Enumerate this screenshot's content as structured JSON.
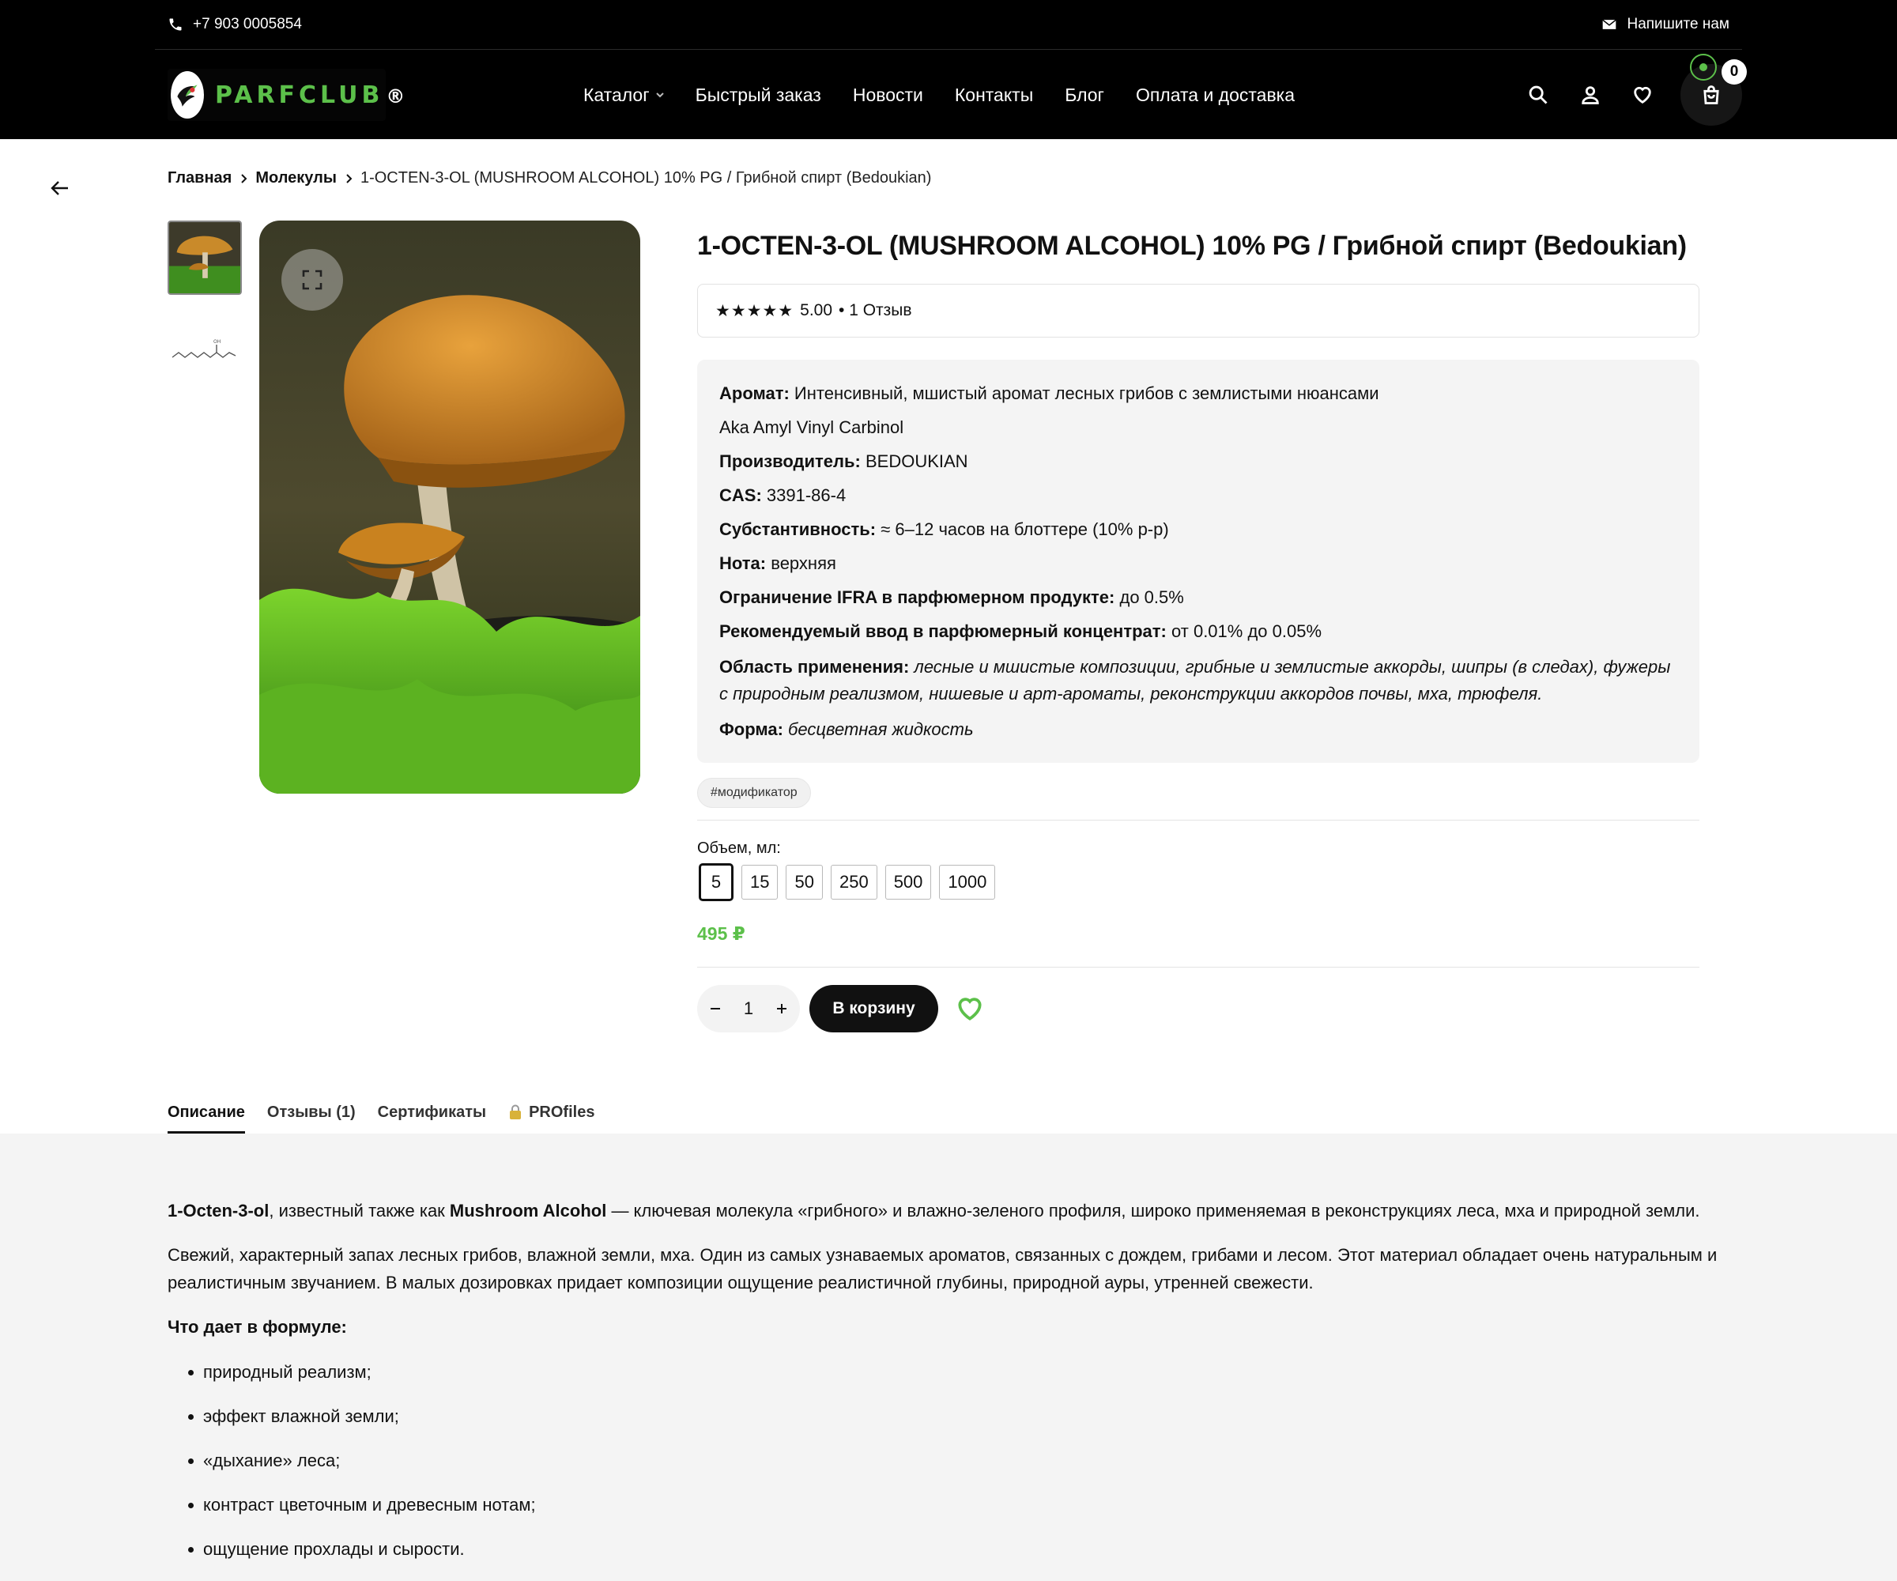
{
  "topbar": {
    "phone": "+7 903 0005854",
    "write_us": "Напишите нам"
  },
  "nav": {
    "logo_text": "PARFCLUB",
    "logo_mark": "®",
    "items": [
      {
        "label": "Каталог"
      },
      {
        "label": "Быстрый заказ"
      },
      {
        "label": "Новости"
      },
      {
        "label": "Контакты"
      },
      {
        "label": "Блог"
      },
      {
        "label": "Оплата и доставка"
      }
    ],
    "cart_count": "0"
  },
  "breadcrumb": {
    "home": "Главная",
    "section": "Молекулы",
    "current": "1-OCTEN-3-OL (MUSHROOM ALCOHOL) 10% PG / Грибной спирт (Bedoukian)"
  },
  "product": {
    "title": "1-OCTEN-3-OL (MUSHROOM ALCOHOL) 10% PG / Грибной спирт (Bedoukian)",
    "stars": "★★★★★",
    "rating": "5.00",
    "reviews_text": "• 1 Отзыв",
    "props": {
      "aroma_label": "Аромат:",
      "aroma_value": "Интенсивный, мшистый аромат лесных грибов с землистыми нюансами",
      "aka": "Aka Amyl Vinyl Carbinol",
      "maker_label": "Производитель:",
      "maker_value": "BEDOUKIAN",
      "cas_label": "CAS:",
      "cas_value": "3391-86-4",
      "subst_label": "Субстантивность:",
      "subst_value": "≈ 6–12 часов на блоттере (10% р-р)",
      "note_label": "Нота:",
      "note_value": "верхняя",
      "ifra_label": "Ограничение IFRA в парфюмерном продукте:",
      "ifra_value": "до 0.5%",
      "dose_label": "Рекомендуемый ввод в парфюмерный концентрат:",
      "dose_value": "от 0.01% до 0.05%",
      "use_label": "Область применения:",
      "use_value": "лесные и мшистые композиции, грибные и землистые аккорды, шипры (в следах), фужеры с природным реализмом, нишевые и арт-ароматы, реконструкции аккордов почвы, мха, трюфеля.",
      "form_label": "Форма:",
      "form_value": "бесцветная жидкость"
    },
    "tag": "#модификатор",
    "volume_label": "Объем, мл:",
    "volumes": [
      "5",
      "15",
      "50",
      "250",
      "500",
      "1000"
    ],
    "price": "495 ₽",
    "quantity": "1",
    "add_to_cart": "В корзину"
  },
  "tabs": {
    "description": "Описание",
    "reviews": "Отзывы (1)",
    "certificates": "Сертификаты",
    "profiles": "PROfiles"
  },
  "description": {
    "p1_bold1": "1-Octen-3-ol",
    "p1_text1": ", известный также как ",
    "p1_bold2": "Mushroom Alcohol",
    "p1_text2": " — ключевая молекула «грибного» и влажно-зеленого профиля, широко применяемая в реконструкциях леса, мха и природной земли.",
    "p2": "Свежий, характерный запах лесных грибов, влажной земли, мха. Один из самых узнаваемых ароматов, связанных с дождем, грибами и лесом. Этот материал обладает очень натуральным и реалистичным звучанием. В малых дозировках придает композиции ощущение реалистичной глубины, природной ауры, утренней свежести.",
    "heading": "Что дает в формуле:",
    "bullets": [
      "природный реализм;",
      "эффект влажной земли;",
      "«дыхание» леса;",
      "контраст цветочным и древесным нотам;",
      "ощущение прохлады и сырости."
    ]
  },
  "colors": {
    "accent_green": "#5cc04a",
    "header_bg": "#000000",
    "panel_bg": "#f4f4f4"
  }
}
